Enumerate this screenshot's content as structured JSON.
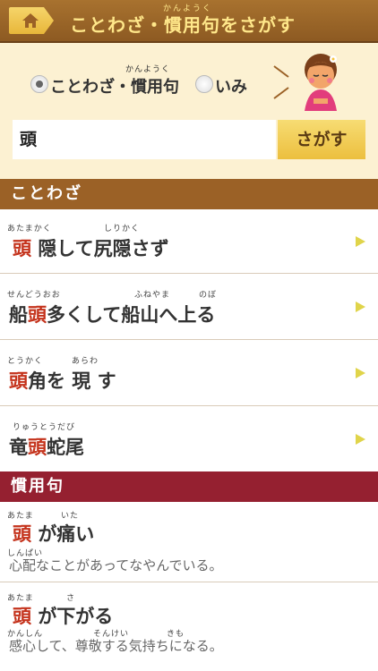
{
  "header": {
    "title": "ことわざ・慣用句をさがす",
    "title_furigana": "かんようく"
  },
  "search": {
    "options": [
      {
        "label": "ことわざ・慣用句",
        "furigana": "かんようく",
        "selected": true
      },
      {
        "label": "いみ",
        "selected": false
      }
    ],
    "query": "頭",
    "button_label": "さがす"
  },
  "sections": {
    "kotowaza": "ことわざ",
    "kanyouku": "慣用句"
  },
  "kotowaza_items": [
    {
      "furigana": [
        "あたまかく",
        "しりかく"
      ],
      "pre": "",
      "hl": "頭",
      "post": "隠して尻隠さず"
    },
    {
      "furigana": [
        "せんどうおお",
        "ふねやま",
        "のぼ"
      ],
      "pre": "船",
      "hl": "頭",
      "post": "多くして船山へ上る"
    },
    {
      "furigana": [
        "とうかく",
        "あらわ"
      ],
      "pre": "",
      "hl": "頭",
      "post": "角を 現 す"
    },
    {
      "furigana": [
        "りゅうとうだび"
      ],
      "pre": "竜",
      "hl": "頭",
      "post": "蛇尾"
    }
  ],
  "kanyouku_items": [
    {
      "furigana": [
        "あたま",
        "いた"
      ],
      "hl": "頭",
      "post": "が痛い",
      "desc_furigana": [
        "しんぱい"
      ],
      "desc": "心配なことがあってなやんでいる。"
    },
    {
      "furigana": [
        "あたま",
        "さ"
      ],
      "hl": "頭",
      "post": "が下がる",
      "desc_furigana": [
        "かんしん",
        "そんけい",
        "きも"
      ],
      "desc": "感心して、尊敬する気持ちになる。"
    }
  ],
  "colors": {
    "header": "#9b6126",
    "accent_text": "#ffe78a",
    "highlight": "#c4321b",
    "kanyouku_header": "#952030",
    "button": "#ecbf3e"
  },
  "icons": {
    "home": "home-icon",
    "row_arrow": "triangle-right-icon",
    "mascot": "girl-mascot-icon"
  }
}
